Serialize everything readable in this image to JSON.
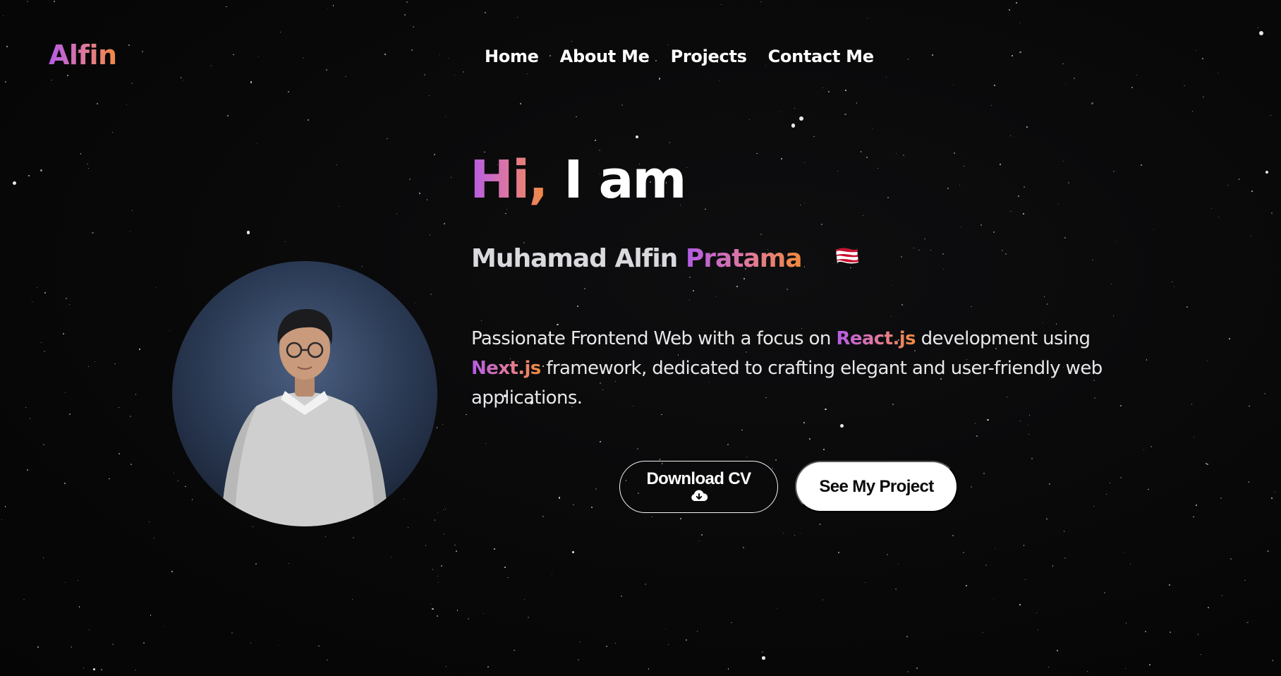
{
  "brand": {
    "logo": "Alfin"
  },
  "nav": {
    "items": [
      {
        "label": "Home"
      },
      {
        "label": "About Me"
      },
      {
        "label": "Projects"
      },
      {
        "label": "Contact Me"
      }
    ]
  },
  "hero": {
    "greeting_highlight": "Hi,",
    "greeting_rest": " I am",
    "name_plain": "Muhamad Alfin ",
    "name_highlight": "Pratama",
    "flag_icon": "waving-flag-icon",
    "description": {
      "part1": "Passionate Frontend Web with a focus on ",
      "highlight1": "React.js",
      "part2": " development using ",
      "highlight2": "Next.js",
      "part3": " framework, dedicated to crafting elegant and user-friendly web applications."
    }
  },
  "buttons": {
    "download_label": "Download CV",
    "download_icon": "cloud-download-icon",
    "projects_label": "See My Project"
  },
  "colors": {
    "gradient_start": "#b25ce6",
    "gradient_end": "#f08a3c",
    "background": "#080808"
  }
}
